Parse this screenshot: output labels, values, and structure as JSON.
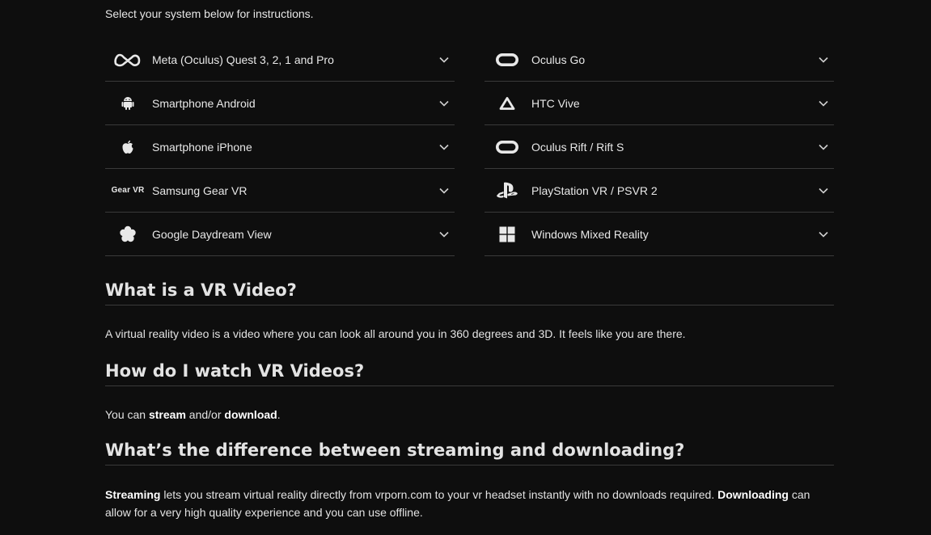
{
  "intro": "Select your system below for instructions.",
  "systems_left": [
    {
      "label": "Meta (Oculus) Quest 3, 2, 1 and Pro",
      "icon": "meta-logo-icon"
    },
    {
      "label": "Smartphone Android",
      "icon": "android-icon"
    },
    {
      "label": "Smartphone iPhone",
      "icon": "apple-icon"
    },
    {
      "label": "Samsung Gear VR",
      "icon": "gear-vr-logo-icon",
      "icon_text": "Gear VR"
    },
    {
      "label": "Google Daydream View",
      "icon": "daydream-icon"
    }
  ],
  "systems_right": [
    {
      "label": "Oculus Go",
      "icon": "oculus-icon"
    },
    {
      "label": "HTC Vive",
      "icon": "htc-vive-icon"
    },
    {
      "label": "Oculus Rift / Rift S",
      "icon": "oculus-icon"
    },
    {
      "label": "PlayStation VR / PSVR 2",
      "icon": "playstation-icon"
    },
    {
      "label": "Windows Mixed Reality",
      "icon": "windows-icon"
    }
  ],
  "faq": {
    "q1": {
      "title": "What is a VR Video?",
      "text": "A virtual reality video is a video where you can look all around you in 360 degrees and 3D. It feels like you are there."
    },
    "q2": {
      "title": "How do I watch VR Videos?",
      "text_before": "You can ",
      "bold_1": "stream",
      "text_mid": " and/or ",
      "bold_2": "download",
      "text_after": "."
    },
    "q3": {
      "title": "What’s the difference between streaming and downloading?",
      "bold_1": "Streaming",
      "text_1": " lets you stream virtual reality directly from vrporn.com to your vr headset instantly with no downloads required. ",
      "bold_2": "Downloading",
      "text_2": " can allow for a very high quality experience and you can use offline."
    }
  },
  "colors": {
    "background": "#0e0e0e",
    "text": "#e8e8e8",
    "divider": "#3a3a3a"
  }
}
